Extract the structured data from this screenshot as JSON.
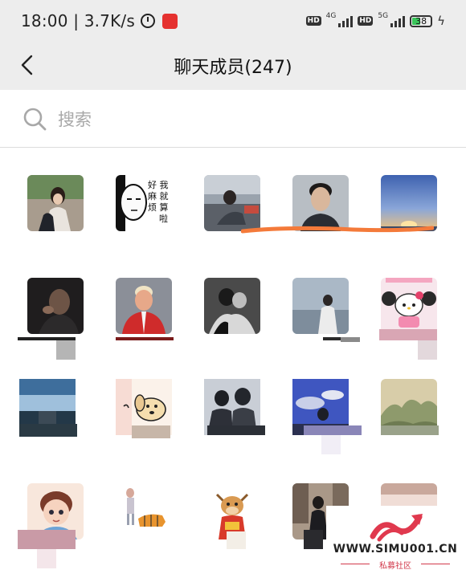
{
  "status_bar": {
    "time_speed": "18:00 | 3.7K/s",
    "hd_badge": "HD",
    "network_1": "4G",
    "network_2": "5G",
    "battery": "38"
  },
  "header": {
    "title": "聊天成员(247)"
  },
  "search": {
    "placeholder": "搜索"
  },
  "members": [
    {
      "icon": "avatar-photo-couple",
      "color": "#8a7a6a"
    },
    {
      "icon": "avatar-meme-saitama",
      "color": "#ffffff",
      "caption": "好麻烦 我就算啦"
    },
    {
      "icon": "avatar-photo-couple-car",
      "color": "#7a7f86"
    },
    {
      "icon": "avatar-photo-man-portrait",
      "color": "#a9b0b6"
    },
    {
      "icon": "avatar-photo-sunset-sky",
      "color": "#5b7fc0"
    },
    {
      "icon": "avatar-photo-dark-portrait",
      "color": "#2b2a2c"
    },
    {
      "icon": "avatar-photo-red-jacket",
      "color": "#c23030"
    },
    {
      "icon": "avatar-photo-black-white",
      "color": "#3a3a3a"
    },
    {
      "icon": "avatar-photo-man-seaside",
      "color": "#9fb1c2"
    },
    {
      "icon": "avatar-hello-kitty",
      "color": "#f2d6e0"
    },
    {
      "icon": "avatar-photo-cloud-landscape",
      "color": "#6f8aa6"
    },
    {
      "icon": "avatar-cartoon-dog",
      "color": "#f1e6d0"
    },
    {
      "icon": "avatar-photo-two-people-dark",
      "color": "#4e5560"
    },
    {
      "icon": "avatar-photo-blue-sky",
      "color": "#6c7ac8"
    },
    {
      "icon": "avatar-painting-landscape",
      "color": "#b5a582"
    },
    {
      "icon": "avatar-cartoon-boy",
      "color": "#f0d2c4"
    },
    {
      "icon": "avatar-drawing-tiger",
      "color": "#ffffff"
    },
    {
      "icon": "avatar-cartoon-cow",
      "color": "#f3ecd6"
    },
    {
      "icon": "avatar-photo-street",
      "color": "#7d6f63"
    },
    {
      "icon": "avatar-photo-partial",
      "color": "#e5c8c0"
    }
  ],
  "watermark": {
    "url": "WWW.SIMU001.CN",
    "subtitle": "私募社区"
  },
  "colors": {
    "header_bg": "#ededed",
    "placeholder_gray": "#a8a8a8",
    "divider": "#dcdcdc",
    "battery_green": "#3ac55a",
    "brush_orange": "#f47a3a",
    "watermark_red": "#d23a4c"
  }
}
